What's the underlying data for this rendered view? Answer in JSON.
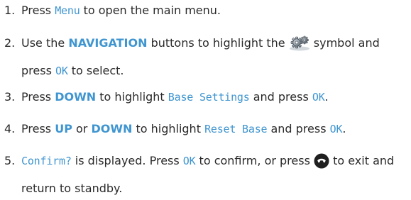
{
  "steps": [
    {
      "number": "1.",
      "parts": {
        "a": "Press ",
        "lcd1": "Menu",
        "b": " to open the main menu."
      }
    },
    {
      "number": "2.",
      "parts": {
        "a": "Use the ",
        "key1": "NAVIGATION",
        "b": " buttons to highlight the ",
        "icon": "settings-gears-icon",
        "c": " symbol and press ",
        "lcd1": "OK",
        "d": " to select."
      }
    },
    {
      "number": "3.",
      "parts": {
        "a": "Press ",
        "key1": "DOWN",
        "b": " to highlight ",
        "lcd1": "Base Settings",
        "c": " and press ",
        "lcd2": "OK",
        "d": "."
      }
    },
    {
      "number": "4.",
      "parts": {
        "a": "Press ",
        "key1": "UP",
        "b": " or ",
        "key2": "DOWN",
        "c": " to highlight ",
        "lcd1": "Reset Base",
        "d": " and press ",
        "lcd2": "OK",
        "e": "."
      }
    },
    {
      "number": "5.",
      "parts": {
        "lcd1": "Confirm?",
        "a": " is displayed. Press ",
        "lcd2": "OK",
        "b": " to confirm, or press ",
        "icon": "end-call-handset-icon",
        "c": " to exit and return to standby."
      }
    }
  ],
  "colors": {
    "text": "#2a2a2a",
    "accent": "#3f95d0"
  }
}
